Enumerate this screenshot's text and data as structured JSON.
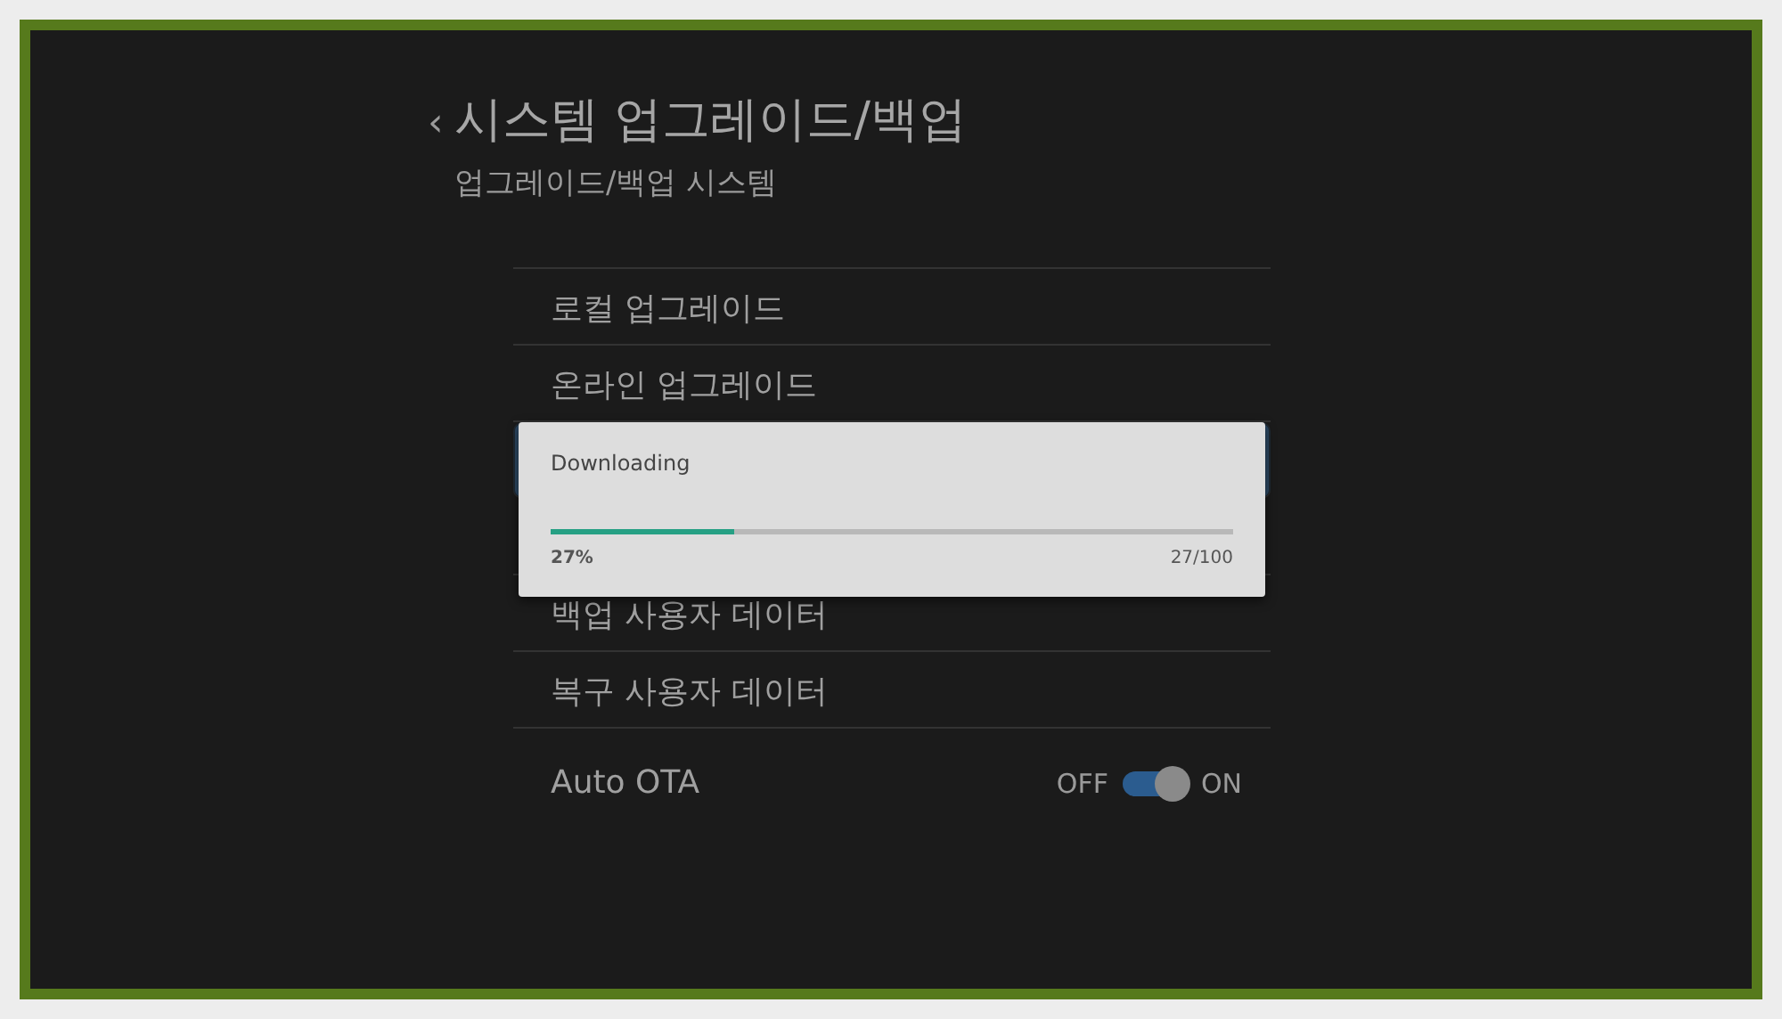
{
  "header": {
    "back_glyph": "‹",
    "title": "시스템 업그레이드/백업",
    "subtitle": "업그레이드/백업 시스템"
  },
  "menu": [
    {
      "label": "로컬 업그레이드",
      "selected": false
    },
    {
      "label": "온라인 업그레이드",
      "selected": false
    },
    {
      "selected": true
    },
    {
      "selected": false
    },
    {
      "label": "백업 사용자 데이터",
      "selected": false
    },
    {
      "label": "복구 사용자 데이터",
      "selected": false
    }
  ],
  "auto_ota": {
    "label": "Auto OTA",
    "off_label": "OFF",
    "on_label": "ON",
    "on": true
  },
  "dialog": {
    "title": "Downloading",
    "level": 0.27,
    "percent": "27%",
    "count": "27/100"
  }
}
